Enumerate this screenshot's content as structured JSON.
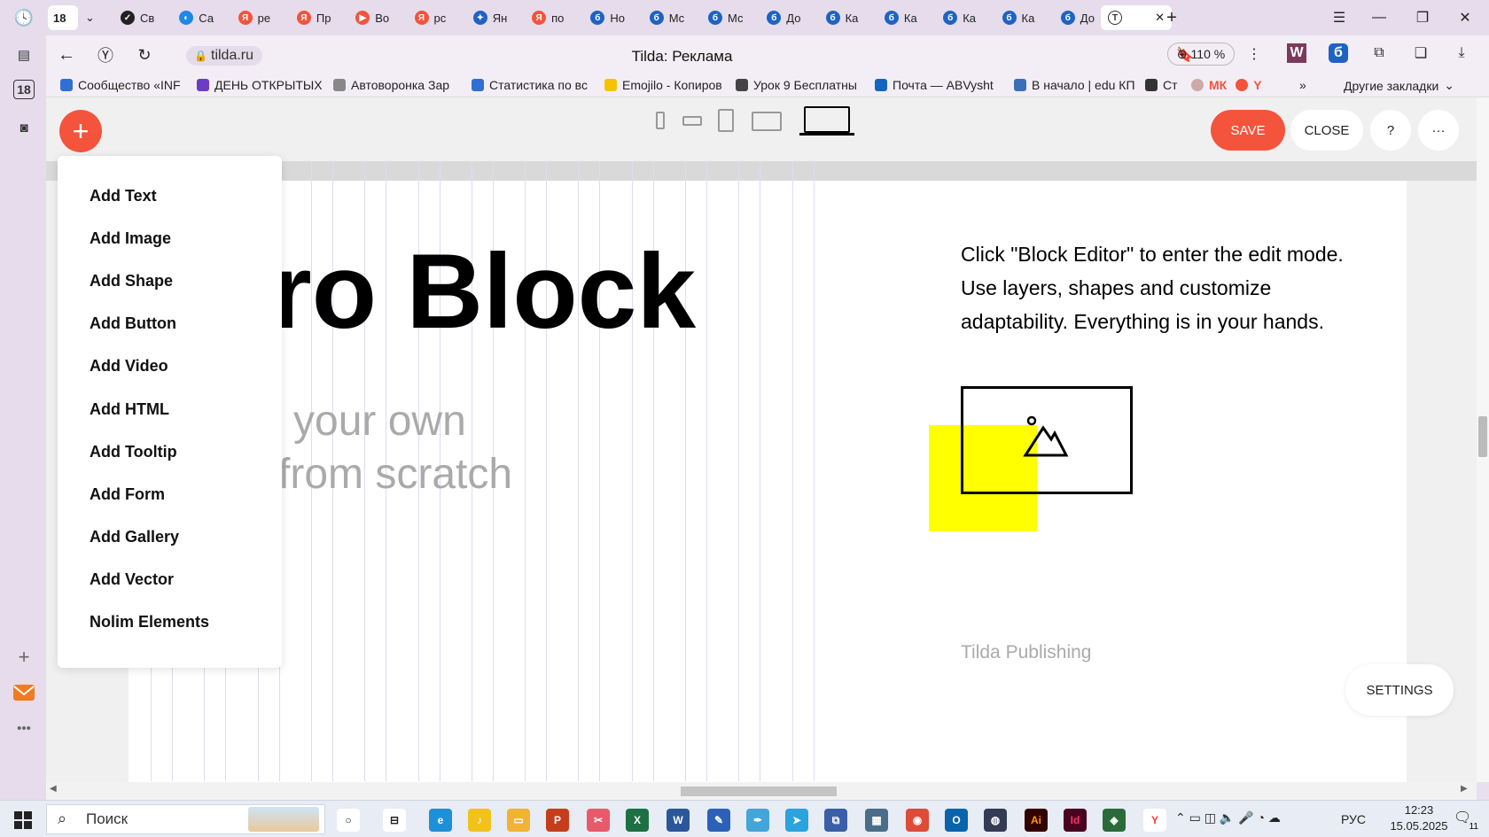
{
  "browser": {
    "tab_count_badge": "18",
    "tabs": [
      {
        "label": "Св",
        "color": "#222222",
        "glyph": "✓"
      },
      {
        "label": "Са",
        "color": "#1e88e5",
        "glyph": "◐"
      },
      {
        "label": "ре",
        "color": "#f4533c",
        "glyph": "Я"
      },
      {
        "label": "Пр",
        "color": "#f4533c",
        "glyph": "Я"
      },
      {
        "label": "Во",
        "color": "#f4533c",
        "glyph": "▶"
      },
      {
        "label": "рс",
        "color": "#f4533c",
        "glyph": "Я"
      },
      {
        "label": "Ян",
        "color": "#1e63c4",
        "glyph": "✦"
      },
      {
        "label": "по",
        "color": "#f4533c",
        "glyph": "Я"
      },
      {
        "label": "Но",
        "color": "#1e63c4",
        "glyph": "б"
      },
      {
        "label": "Мс",
        "color": "#1e63c4",
        "glyph": "б"
      },
      {
        "label": "Мс",
        "color": "#1e63c4",
        "glyph": "б"
      },
      {
        "label": "До",
        "color": "#1e63c4",
        "glyph": "б"
      },
      {
        "label": "Ка",
        "color": "#1e63c4",
        "glyph": "б"
      },
      {
        "label": "Ка",
        "color": "#1e63c4",
        "glyph": "б"
      },
      {
        "label": "Ка",
        "color": "#1e63c4",
        "glyph": "б"
      },
      {
        "label": "Ка",
        "color": "#1e63c4",
        "glyph": "б"
      },
      {
        "label": "До",
        "color": "#1e63c4",
        "glyph": "б"
      }
    ],
    "active_tab_label": "",
    "url": "tilda.ru",
    "page_title": "Tilda: Реклама",
    "zoom": "110 %",
    "bookmarks": [
      {
        "label": "Сообщество «INF",
        "color": "#2f6fd6"
      },
      {
        "label": "ДЕНЬ ОТКРЫТЫХ",
        "color": "#6a3cc7"
      },
      {
        "label": "Автоворонка Зар",
        "color": "#888888"
      },
      {
        "label": "Статистика по вс",
        "color": "#2f6fd6"
      },
      {
        "label": "Emojilo - Копиров",
        "color": "#f5c400"
      },
      {
        "label": "Урок 9 Бесплатны",
        "color": "#444444"
      },
      {
        "label": "Почта — ABVysht",
        "color": "#1565c0"
      },
      {
        "label": "В начало | edu КП",
        "color": "#3a6fb7"
      },
      {
        "label": "Ст",
        "color": "#333333"
      }
    ],
    "other_bookmarks": "Другие закладки",
    "more_bookmarks": "»",
    "side_badge": "18"
  },
  "editor": {
    "save_label": "SAVE",
    "close_label": "CLOSE",
    "help_label": "?",
    "more_label": "···",
    "add_symbol": "+",
    "menu_items": [
      "Add Text",
      "Add Image",
      "Add Shape",
      "Add Button",
      "Add Video",
      "Add HTML",
      "Add Tooltip",
      "Add Form",
      "Add Gallery",
      "Add Vector",
      "Nolim Elements"
    ],
    "title": "ro Block",
    "subtitle_line1": "your own",
    "subtitle_line2": "from scratch",
    "description": "Click \"Block Editor\" to enter the edit mode. Use layers, shapes and customize adaptability. Everything is in your hands.",
    "footer_text": "Tilda Publishing",
    "settings_label": "SETTINGS",
    "accent_color": "#f4533c",
    "shape_color": "#ffff00"
  },
  "taskbar": {
    "search_placeholder": "Поиск",
    "lang": "РУС",
    "time": "12:23",
    "date": "15.05.2025",
    "notif_count": "11"
  }
}
